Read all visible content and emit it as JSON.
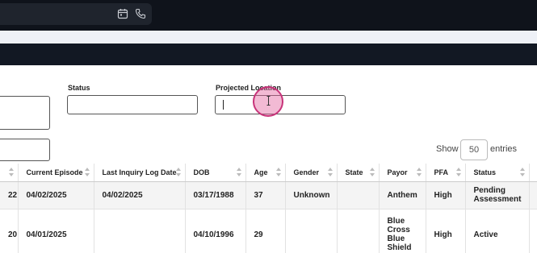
{
  "topbar": {
    "icons": [
      "calendar-icon",
      "phone-icon"
    ]
  },
  "filters": {
    "status_label": "Status",
    "status_value": "",
    "projected_location_label": "Projected Location",
    "projected_location_value": ""
  },
  "entries": {
    "show_label": "Show",
    "value": "50",
    "suffix": "entries"
  },
  "table": {
    "columns": [
      "",
      "Current Episode",
      "Last Inquiry Log Date",
      "DOB",
      "Age",
      "Gender",
      "State",
      "Payor",
      "PFA",
      "Status",
      ""
    ],
    "rows": [
      {
        "id_tail": "22",
        "current_episode": "04/02/2025",
        "last_inquiry": "04/02/2025",
        "dob": "03/17/1988",
        "age": "37",
        "gender": "Unknown",
        "state": "",
        "payor": "Anthem",
        "pfa": "High",
        "status": "Pending Assessment"
      },
      {
        "id_tail": "20",
        "current_episode": "04/01/2025",
        "last_inquiry": "",
        "dob": "04/10/1996",
        "age": "29",
        "gender": "",
        "state": "",
        "payor": "Blue Cross Blue Shield",
        "pfa": "High",
        "status": "Active"
      }
    ]
  }
}
